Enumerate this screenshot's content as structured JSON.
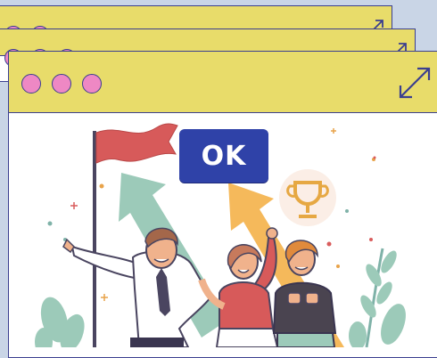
{
  "dialog": {
    "button_label": "OK"
  },
  "windows": [
    {
      "name": "back-window"
    },
    {
      "name": "middle-window"
    },
    {
      "name": "front-window"
    }
  ],
  "colors": {
    "titlebar": "#e8dc6a",
    "window_dot": "#ee88c4",
    "outline": "#3b3f8f",
    "button": "#2f42a8",
    "button_text": "#ffffff",
    "background": "#c9d5e6"
  },
  "icons": {
    "window_controls": "window-dot-icon",
    "maximize": "maximize-icon",
    "illustration": "team-success-illustration"
  }
}
